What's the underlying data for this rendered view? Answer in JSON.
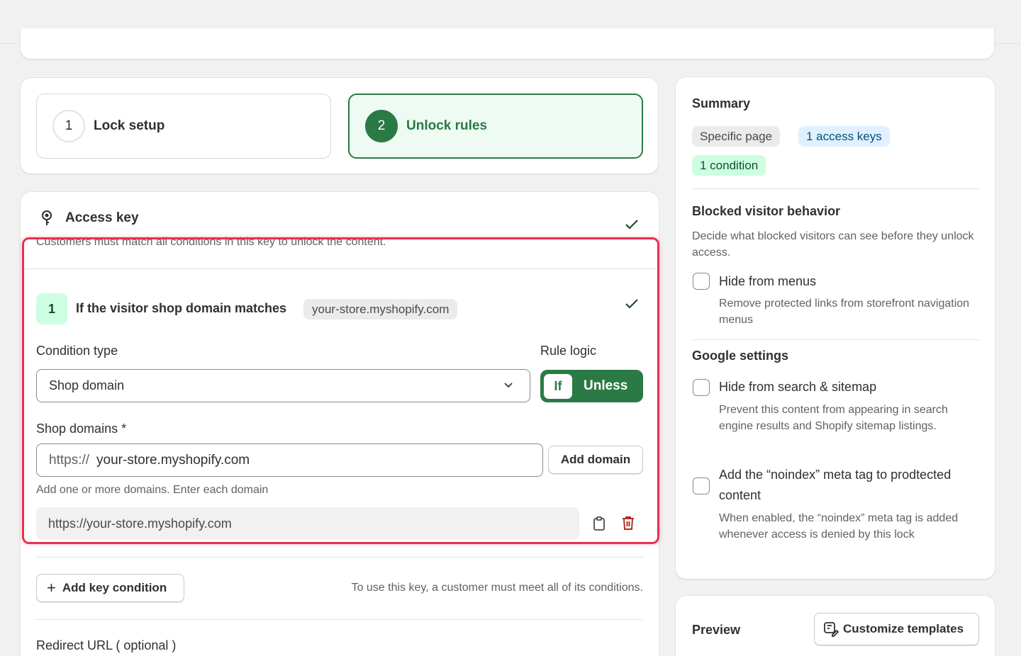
{
  "steps": [
    {
      "number": "1",
      "label": "Lock setup"
    },
    {
      "number": "2",
      "label": "Unlock rules"
    }
  ],
  "access_key": {
    "title": "Access key",
    "description": "Customers must match all conditions in this key to unlock the content.",
    "condition": {
      "number": "1",
      "title": "If the visitor shop domain matches",
      "pill": "your-store.myshopify.com",
      "type_label": "Condition type",
      "type_value": "Shop domain",
      "logic_label": "Rule logic",
      "logic_if": "If",
      "logic_unless": "Unless",
      "domains_label": "Shop domains *",
      "domain_prefix": "https://",
      "domain_value": "your-store.myshopify.com",
      "add_domain": "Add domain",
      "help": "Add one or more domains. Enter each domain",
      "domain_item": "https://your-store.myshopify.com"
    },
    "add_condition": "Add key condition",
    "condition_note": "To use this key, a customer must meet all of its conditions.",
    "redirect_label": "Redirect URL ( optional )"
  },
  "summary": {
    "title": "Summary",
    "badges": [
      "Specific page",
      "1 access keys",
      "1 condition"
    ],
    "blocked": {
      "title": "Blocked visitor behavior",
      "desc": "Decide what blocked visitors can see before they unlock access.",
      "hide_menus_label": "Hide from menus",
      "hide_menus_help": "Remove protected links from storefront navigation menus"
    },
    "google": {
      "title": "Google settings",
      "hide_search_label": "Hide from search & sitemap",
      "hide_search_help": "Prevent this content from appearing in search engine results and Shopify sitemap listings.",
      "noindex_label": "Add the “noindex” meta tag to prodtected content",
      "noindex_help": "When enabled, the “noindex” meta tag is added whenever access is denied by this lock"
    }
  },
  "preview": {
    "title": "Preview",
    "customize": "Customize templates"
  },
  "colors": {
    "accent": "#2b7a45",
    "highlight": "#e5334f"
  }
}
